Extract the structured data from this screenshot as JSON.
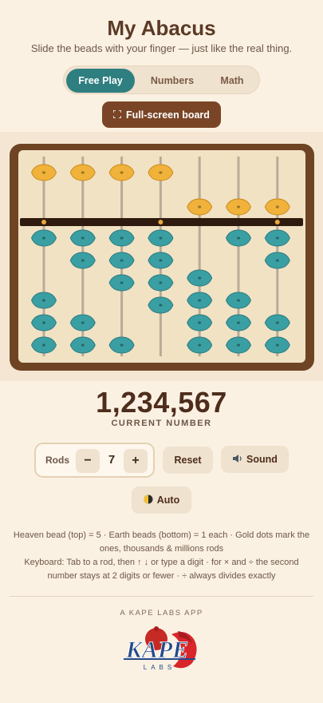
{
  "header": {
    "title": "My Abacus",
    "subtitle": "Slide the beads with your finger — just like the real thing."
  },
  "tabs": [
    {
      "label": "Free Play",
      "active": true
    },
    {
      "label": "Numbers",
      "active": false
    },
    {
      "label": "Math",
      "active": false
    }
  ],
  "fullscreen_button": {
    "icon": "expand-icon",
    "label": "Full-screen board"
  },
  "abacus": {
    "rods": 7,
    "digits": [
      1,
      2,
      3,
      4,
      5,
      6,
      7
    ],
    "gold_dot_rods": [
      1,
      4,
      7
    ],
    "colors": {
      "heaven_bead": "#f0b23a",
      "earth_bead": "#3a9fa3",
      "frame": "#6e4424",
      "beam": "#2e1a0e",
      "dot": "#e8a93a"
    }
  },
  "display": {
    "number": "1,234,567",
    "label": "CURRENT NUMBER"
  },
  "controls": {
    "rods_label": "Rods",
    "rods_value": "7",
    "minus": "−",
    "plus": "+",
    "reset": "Reset",
    "sound": "Sound",
    "sound_icon": "speaker-icon",
    "auto": "Auto",
    "auto_icon": "half-moon-icon"
  },
  "help": {
    "line1": "Heaven bead (top) = 5 · Earth beads (bottom) = 1 each · Gold dots mark the ones, thousands & millions rods",
    "line2": "Keyboard: Tab to a rod, then ↑ ↓ or type a digit · for × and ÷ the second number stays at 2 digits or fewer · ÷ always divides exactly"
  },
  "footer": {
    "credit": "A KAPE LABS APP",
    "logo_text": "KAPE",
    "logo_subtext": "LABS"
  }
}
